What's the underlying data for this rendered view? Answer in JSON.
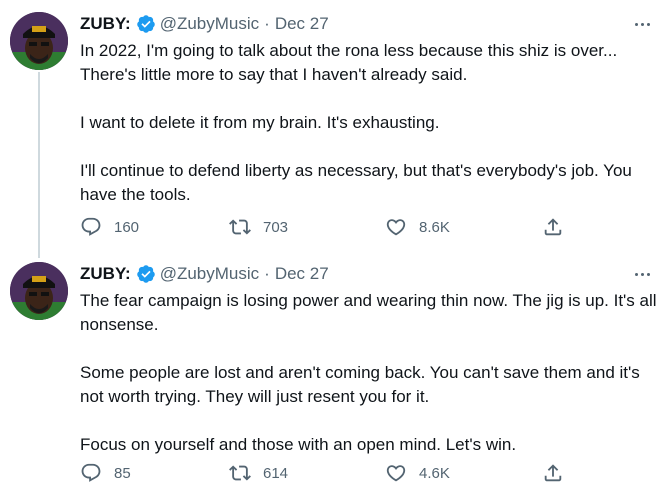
{
  "tweets": [
    {
      "name": "ZUBY:",
      "handle": "@ZubyMusic",
      "separator": "·",
      "date": "Dec 27",
      "paragraphs": [
        "In 2022, I'm going to talk about the rona less because this shiz is over... There's little more to say that I haven't already said.",
        "I want to delete it from my brain. It's exhausting.",
        "I'll continue to defend liberty as necessary, but that's everybody's job. You have the tools."
      ],
      "replies": "160",
      "retweets": "703",
      "likes": "8.6K"
    },
    {
      "name": "ZUBY:",
      "handle": "@ZubyMusic",
      "separator": "·",
      "date": "Dec 27",
      "paragraphs": [
        "The fear campaign is losing power and wearing thin now. The jig is up. It's all nonsense.",
        "Some people are lost and aren't coming back. You can't save them and it's not worth trying.  They will just resent you for it.",
        "Focus on yourself and those with an open mind. Let's win."
      ],
      "replies": "85",
      "retweets": "614",
      "likes": "4.6K"
    }
  ],
  "icons": {
    "verified": "verified-badge-icon",
    "more": "more-options-icon",
    "reply": "reply-icon",
    "retweet": "retweet-icon",
    "like": "heart-icon",
    "share": "share-icon"
  },
  "colors": {
    "verified": "#1d9bf0",
    "secondary_text": "#536471",
    "primary_text": "#0f1419",
    "thread_line": "#cfd9de"
  }
}
